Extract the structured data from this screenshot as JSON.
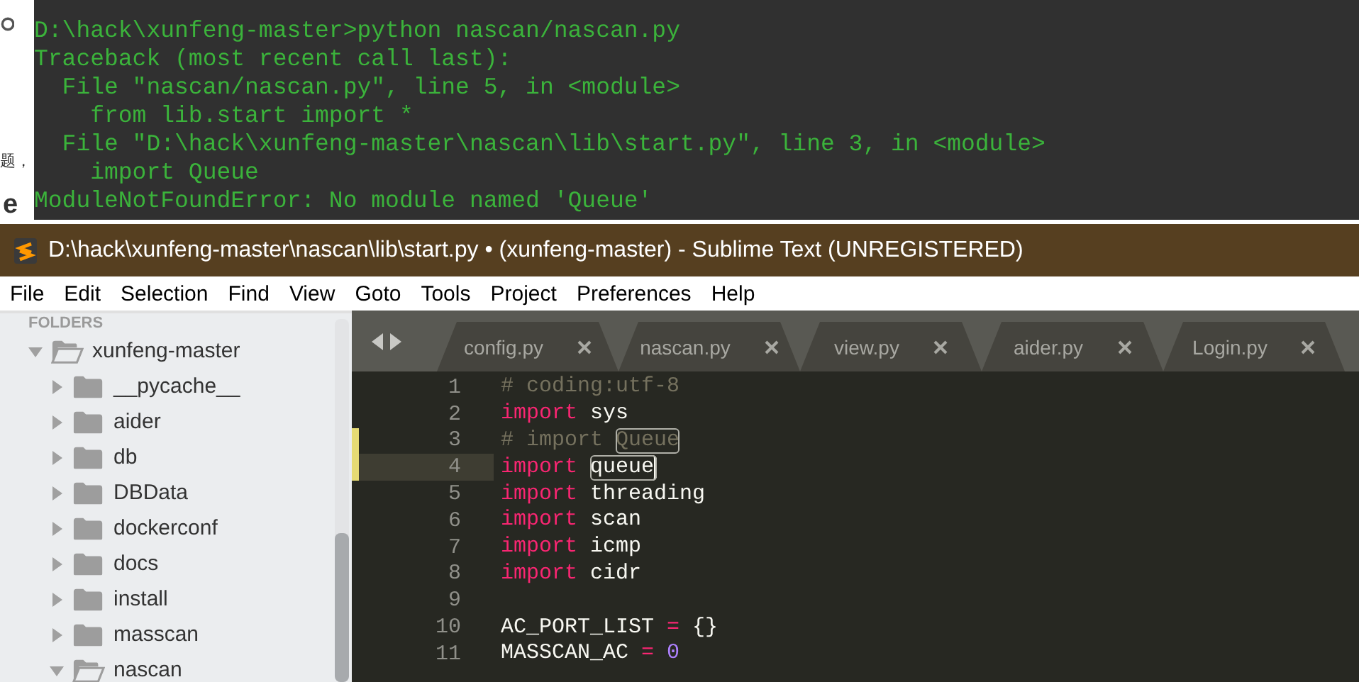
{
  "background_page": {
    "texts": [
      "题，",
      "e"
    ]
  },
  "terminal": {
    "lines": [
      "D:\\hack\\xunfeng-master>python nascan/nascan.py",
      "Traceback (most recent call last):",
      "  File \"nascan/nascan.py\", line 5, in <module>",
      "    from lib.start import *",
      "  File \"D:\\hack\\xunfeng-master\\nascan\\lib\\start.py\", line 3, in <module>",
      "    import Queue",
      "ModuleNotFoundError: No module named 'Queue'"
    ]
  },
  "window": {
    "title": "D:\\hack\\xunfeng-master\\nascan\\lib\\start.py • (xunfeng-master) - Sublime Text (UNREGISTERED)"
  },
  "menu": [
    "File",
    "Edit",
    "Selection",
    "Find",
    "View",
    "Goto",
    "Tools",
    "Project",
    "Preferences",
    "Help"
  ],
  "sidebar": {
    "header": "FOLDERS",
    "items": [
      {
        "label": "xunfeng-master",
        "expanded": true,
        "children": [
          {
            "label": "__pycache__",
            "expanded": false
          },
          {
            "label": "aider",
            "expanded": false
          },
          {
            "label": "db",
            "expanded": false
          },
          {
            "label": "DBData",
            "expanded": false
          },
          {
            "label": "dockerconf",
            "expanded": false
          },
          {
            "label": "docs",
            "expanded": false
          },
          {
            "label": "install",
            "expanded": false
          },
          {
            "label": "masscan",
            "expanded": false
          },
          {
            "label": "nascan",
            "expanded": true
          }
        ]
      }
    ]
  },
  "tabs": [
    {
      "label": "config.py",
      "selected": false
    },
    {
      "label": "nascan.py",
      "selected": false
    },
    {
      "label": "view.py",
      "selected": false
    },
    {
      "label": "aider.py",
      "selected": false
    },
    {
      "label": "Login.py",
      "selected": false
    }
  ],
  "editor": {
    "lines": [
      {
        "number": "1",
        "modified": false,
        "current": false,
        "tokens": [
          {
            "text": "# coding:utf-8",
            "kind": "comment"
          }
        ]
      },
      {
        "number": "2",
        "modified": false,
        "current": false,
        "tokens": [
          {
            "text": "import",
            "kind": "keyword"
          },
          {
            "text": " sys",
            "kind": "plain"
          }
        ]
      },
      {
        "number": "3",
        "modified": true,
        "current": false,
        "tokens": [
          {
            "text": "# import ",
            "kind": "comment"
          },
          {
            "text": "Queue",
            "kind": "comment",
            "boxed": true
          }
        ]
      },
      {
        "number": "4",
        "modified": true,
        "current": true,
        "tokens": [
          {
            "text": "import ",
            "kind": "keyword"
          },
          {
            "text": "queue",
            "kind": "plain",
            "boxed": true,
            "cursor": true
          }
        ]
      },
      {
        "number": "5",
        "modified": false,
        "current": false,
        "tokens": [
          {
            "text": "import",
            "kind": "keyword"
          },
          {
            "text": " threading",
            "kind": "plain"
          }
        ]
      },
      {
        "number": "6",
        "modified": false,
        "current": false,
        "tokens": [
          {
            "text": "import",
            "kind": "keyword"
          },
          {
            "text": " scan",
            "kind": "plain"
          }
        ]
      },
      {
        "number": "7",
        "modified": false,
        "current": false,
        "tokens": [
          {
            "text": "import",
            "kind": "keyword"
          },
          {
            "text": " icmp",
            "kind": "plain"
          }
        ]
      },
      {
        "number": "8",
        "modified": false,
        "current": false,
        "tokens": [
          {
            "text": "import",
            "kind": "keyword"
          },
          {
            "text": " cidr",
            "kind": "plain"
          }
        ]
      },
      {
        "number": "9",
        "modified": false,
        "current": false
      },
      {
        "number": "10",
        "modified": false,
        "current": false,
        "tokens": [
          {
            "text": "AC_PORT_LIST ",
            "kind": "plain"
          },
          {
            "text": "=",
            "kind": "operator"
          },
          {
            "text": " {}",
            "kind": "plain"
          }
        ]
      },
      {
        "number": "11",
        "modified": false,
        "current": false,
        "tokens": [
          {
            "text": "MASSCAN_AC ",
            "kind": "plain"
          },
          {
            "text": "= ",
            "kind": "operator"
          },
          {
            "text": "0",
            "kind": "number"
          }
        ]
      }
    ]
  }
}
